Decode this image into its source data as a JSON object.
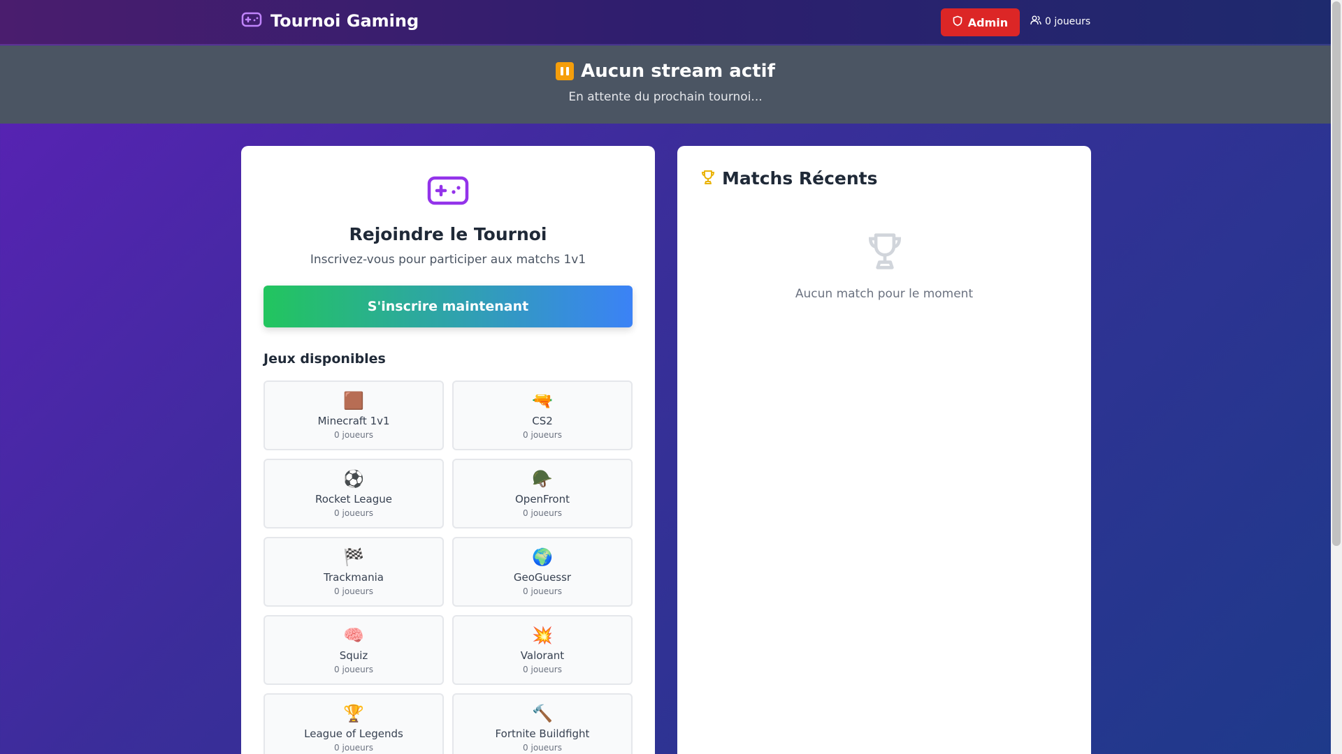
{
  "header": {
    "title": "Tournoi Gaming",
    "admin_label": "Admin",
    "players_label": "0 joueurs"
  },
  "stream": {
    "title": "Aucun stream actif",
    "subtitle": "En attente du prochain tournoi..."
  },
  "join": {
    "title": "Rejoindre le Tournoi",
    "subtitle": "Inscrivez-vous pour participer aux matchs 1v1",
    "button_label": "S'inscrire maintenant",
    "games_heading": "Jeux disponibles",
    "games": [
      {
        "emoji": "🟫",
        "icon": "minecraft-block-icon",
        "name": "Minecraft 1v1",
        "players": "0 joueurs"
      },
      {
        "emoji": "🔫",
        "icon": "pistol-icon",
        "name": "CS2",
        "players": "0 joueurs"
      },
      {
        "emoji": "⚽",
        "icon": "soccer-ball-icon",
        "name": "Rocket League",
        "players": "0 joueurs"
      },
      {
        "emoji": "🪖",
        "icon": "helmet-icon",
        "name": "OpenFront",
        "players": "0 joueurs"
      },
      {
        "emoji": "🏁",
        "icon": "checkered-flag-icon",
        "name": "Trackmania",
        "players": "0 joueurs"
      },
      {
        "emoji": "🌍",
        "icon": "globe-icon",
        "name": "GeoGuessr",
        "players": "0 joueurs"
      },
      {
        "emoji": "🧠",
        "icon": "brain-icon",
        "name": "Squiz",
        "players": "0 joueurs"
      },
      {
        "emoji": "💥",
        "icon": "explosion-icon",
        "name": "Valorant",
        "players": "0 joueurs"
      },
      {
        "emoji": "🏆",
        "icon": "trophy-icon",
        "name": "League of Legends",
        "players": "0 joueurs"
      },
      {
        "emoji": "🔨",
        "icon": "hammer-icon",
        "name": "Fortnite Buildfight",
        "players": "0 joueurs"
      }
    ]
  },
  "matches": {
    "title": "Matchs Récents",
    "empty_text": "Aucun match pour le moment"
  },
  "colors": {
    "accent_purple": "#9333ea",
    "admin_red": "#dc2626",
    "gradient_green": "#22c55e",
    "gradient_blue": "#3b82f6",
    "trophy_gold": "#eab308"
  }
}
